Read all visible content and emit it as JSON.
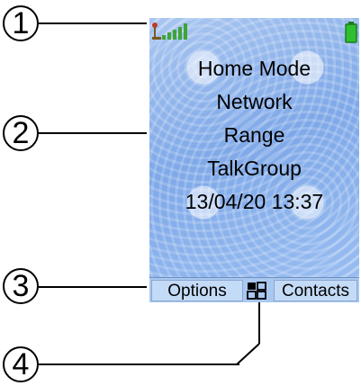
{
  "callouts": [
    "1",
    "2",
    "3",
    "4"
  ],
  "status_bar": {
    "icons": [
      "antenna-icon",
      "signal-strength-icon",
      "battery-icon"
    ],
    "colors": {
      "signal": "#3fa535",
      "battery": "#2fbf2f",
      "antenna": "#c0392b"
    }
  },
  "info": {
    "mode": "Home Mode",
    "network": "Network",
    "range": "Range",
    "talkgroup": "TalkGroup",
    "datetime": "13/04/20 13:37"
  },
  "softkeys": {
    "left": "Options",
    "center_icon": "menu-grid-icon",
    "right": "Contacts"
  }
}
